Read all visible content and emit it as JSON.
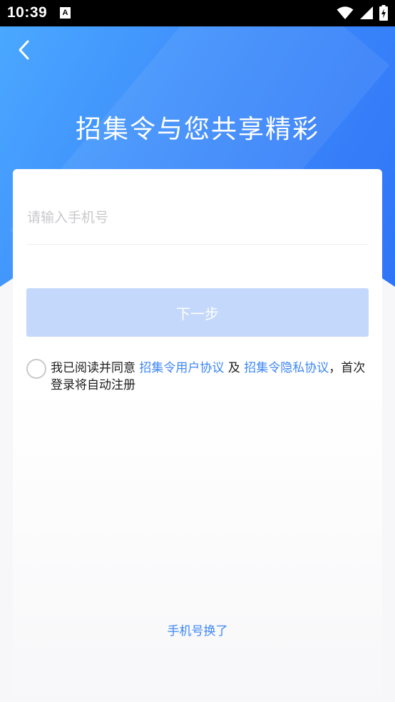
{
  "status_bar": {
    "time": "10:39",
    "notification_glyph": "A"
  },
  "header": {
    "title": "招集令与您共享精彩",
    "back_icon": "chevron-left-icon"
  },
  "form": {
    "phone_placeholder": "请输入手机号",
    "phone_value": "",
    "next_button_label": "下一步"
  },
  "agreement": {
    "prefix": "我已阅读并同意 ",
    "user_agreement": "招集令用户协议",
    "conjunction": " 及 ",
    "privacy_policy": "招集令隐私协议",
    "suffix": "，首次登录将自动注册",
    "checked": false
  },
  "footer": {
    "change_phone_link": "手机号换了"
  },
  "colors": {
    "accent": "#3d86f5",
    "button_disabled": "#c4d8fb",
    "gradient_start": "#4aa8ff",
    "gradient_end": "#2f74f7"
  }
}
